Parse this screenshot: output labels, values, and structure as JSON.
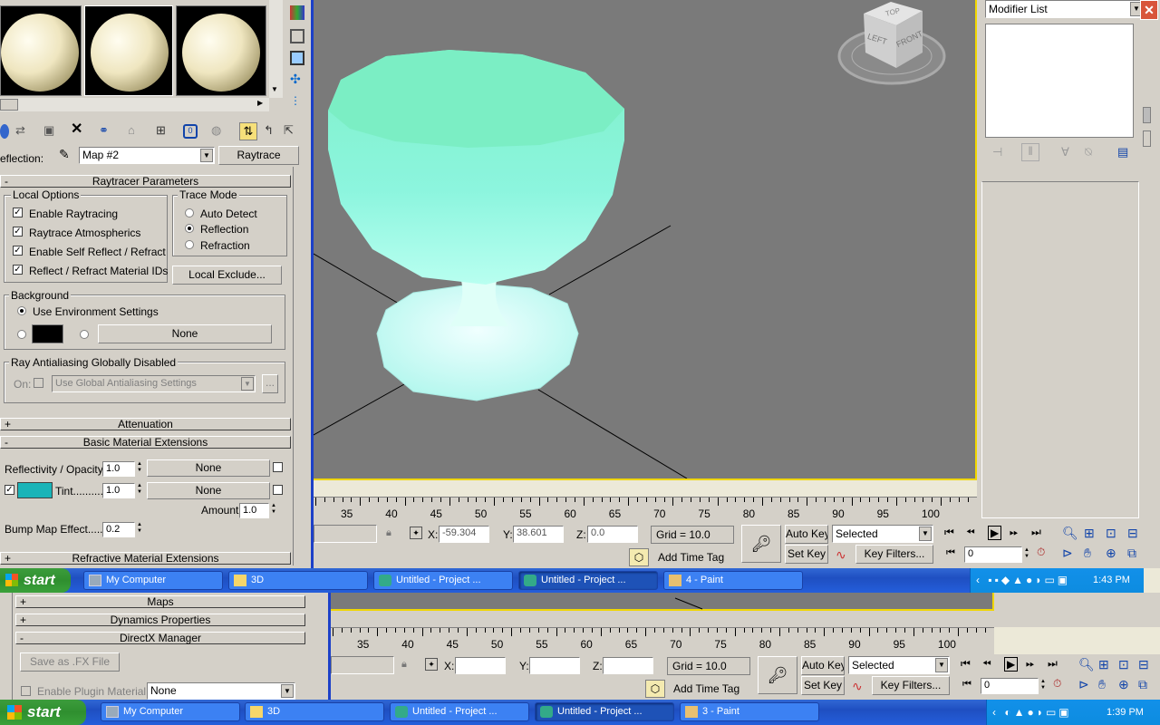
{
  "material_editor": {
    "reflection_label": "eflection:",
    "map_name": "Map #2",
    "map_type": "Raytrace",
    "rollouts": {
      "raytracer": "Raytracer Parameters",
      "attenuation": "Attenuation",
      "basic_ext": "Basic Material Extensions",
      "refractive_ext": "Refractive Material Extensions"
    },
    "local_options": {
      "title": "Local Options",
      "items": [
        "Enable Raytracing",
        "Raytrace Atmospherics",
        "Enable Self Reflect / Refract",
        "Reflect / Refract Material IDs"
      ]
    },
    "trace_mode": {
      "title": "Trace Mode",
      "options": [
        "Auto Detect",
        "Reflection",
        "Refraction"
      ],
      "selected": "Reflection"
    },
    "local_exclude": "Local Exclude...",
    "background": {
      "title": "Background",
      "use_env": "Use Environment Settings",
      "none": "None"
    },
    "antialias": {
      "title": "Ray Antialiasing Globally Disabled",
      "on_label": "On:",
      "setting": "Use Global Antialiasing Settings",
      "dots": "..."
    },
    "basic": {
      "reflectivity_label": "Reflectivity / Opacity..",
      "reflectivity_value": "1.0",
      "none1": "None",
      "tint_label": "Tint..........",
      "tint_value": "1.0",
      "none2": "None",
      "amount_label": "Amount:",
      "amount_value": "1.0",
      "bump_label": "Bump Map Effect..........",
      "bump_value": "0.2"
    },
    "tint_color": "#19b4b8"
  },
  "modifier_list": "Modifier List",
  "viewport": {
    "viewcube": {
      "top": "TOP",
      "left": "LEFT",
      "front": "FRONT"
    }
  },
  "timeline_top": {
    "ticks": [
      "35",
      "40",
      "45",
      "50",
      "55",
      "60",
      "65",
      "70",
      "75",
      "80",
      "85",
      "90",
      "95",
      "100"
    ],
    "x_label": "X:",
    "x_value": "-59.304",
    "y_label": "Y:",
    "y_value": "38.601",
    "z_label": "Z:",
    "z_value": "0.0",
    "grid": "Grid = 10.0",
    "auto_key": "Auto Key",
    "selected": "Selected",
    "set_key": "Set Key",
    "key_filters": "Key Filters...",
    "add_time_tag": "Add Time Tag",
    "frame": "0"
  },
  "taskbar_top": {
    "start": "start",
    "tasks": [
      "My Computer",
      "3D",
      "Untitled     - Project ...",
      "Untitled     - Project ...",
      "4 - Paint"
    ],
    "clock": "1:43 PM"
  },
  "lower_panel": {
    "maps": "Maps",
    "dynamics": "Dynamics Properties",
    "directx": "DirectX Manager",
    "save_fx": "Save as .FX File",
    "enable_plugin": "Enable Plugin Material",
    "plugin_value": "None"
  },
  "timeline_bottom": {
    "ticks": [
      "35",
      "40",
      "45",
      "50",
      "55",
      "60",
      "65",
      "70",
      "75",
      "80",
      "85",
      "90",
      "95",
      "100"
    ],
    "x_label": "X:",
    "y_label": "Y:",
    "z_label": "Z:",
    "grid": "Grid = 10.0",
    "auto_key": "Auto Key",
    "selected": "Selected",
    "set_key": "Set Key",
    "key_filters": "Key Filters...",
    "add_time_tag": "Add Time Tag",
    "frame": "0"
  },
  "taskbar_bottom": {
    "start": "start",
    "tasks": [
      "My Computer",
      "3D",
      "Untitled     - Project ...",
      "Untitled     - Project ...",
      "3 - Paint"
    ],
    "clock": "1:39 PM"
  }
}
